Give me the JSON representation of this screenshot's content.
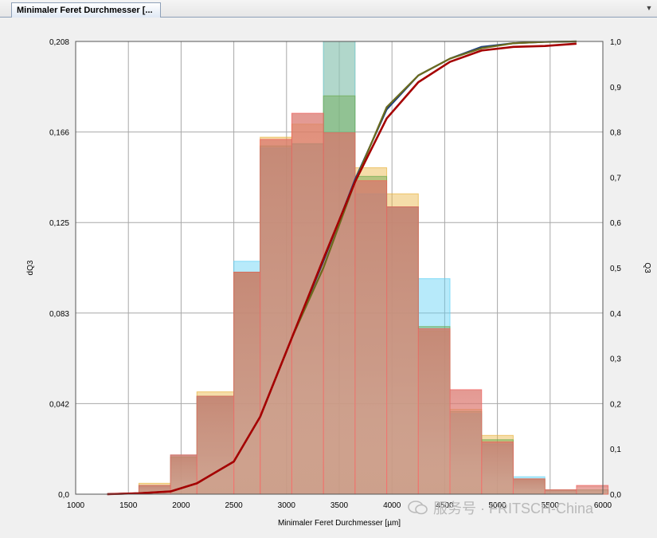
{
  "tab": {
    "title": "Minimaler Feret Durchmesser [..."
  },
  "watermark": {
    "text": "服务号 · FRITSCH-China"
  },
  "colors": {
    "blue": "#5fd0f5",
    "orange": "#e8b440",
    "green": "#6aa84f",
    "red": "#ff4a4a",
    "dark_red": "#a50000",
    "olive": "#6b6b1e",
    "navy": "#1f3f7a",
    "brown_fill": "#c98e80"
  },
  "chart_data": {
    "type": "bar",
    "xlabel": "Minimaler Feret Durchmesser [µm]",
    "ylabel": "dQ3",
    "y2label": "Q3",
    "xlim": [
      1000,
      6000
    ],
    "ylim": [
      0,
      0.208
    ],
    "y2lim": [
      0,
      1.0
    ],
    "x_ticks": [
      "1000",
      "1500",
      "2000",
      "2500",
      "3000",
      "3500",
      "4000",
      "4500",
      "5000",
      "5500",
      "6000"
    ],
    "y_ticks": [
      "0,0",
      "0,042",
      "0,083",
      "0,125",
      "0,166",
      "0,208"
    ],
    "y2_ticks": [
      "0,0",
      "0,1",
      "0,2",
      "0,3",
      "0,4",
      "0,5",
      "0,6",
      "0,7",
      "0,8",
      "0,9",
      "1,0"
    ],
    "bin_edges": [
      1300,
      1600,
      1900,
      2150,
      2500,
      2750,
      3050,
      3350,
      3650,
      3950,
      4250,
      4550,
      4850,
      5150,
      5450,
      5750
    ],
    "histogram_series": [
      {
        "color": "blue",
        "values": [
          0.0,
          0.004,
          0.018,
          0.045,
          0.107,
          0.159,
          0.161,
          0.208,
          0.138,
          0.132,
          0.099,
          0.037,
          0.023,
          0.008,
          0.002,
          0.002
        ]
      },
      {
        "color": "orange",
        "values": [
          0.0,
          0.005,
          0.018,
          0.047,
          0.102,
          0.164,
          0.17,
          0.208,
          0.15,
          0.138,
          0.075,
          0.039,
          0.027,
          0.007,
          0.002,
          0.002
        ]
      },
      {
        "color": "green",
        "values": [
          0.0,
          0.004,
          0.017,
          0.045,
          0.102,
          0.16,
          0.161,
          0.183,
          0.146,
          0.132,
          0.077,
          0.038,
          0.025,
          0.007,
          0.002,
          0.002
        ]
      },
      {
        "color": "red",
        "values": [
          0.0,
          0.004,
          0.018,
          0.045,
          0.102,
          0.163,
          0.175,
          0.166,
          0.144,
          0.132,
          0.076,
          0.048,
          0.024,
          0.007,
          0.002,
          0.004
        ]
      }
    ],
    "cumulative_series": [
      {
        "color": "navy",
        "x": [
          1300,
          1600,
          1900,
          2150,
          2500,
          2750,
          3050,
          3350,
          3650,
          3950,
          4250,
          4550,
          4850,
          5150,
          5450,
          5750
        ],
        "y": [
          0.0,
          0.002,
          0.006,
          0.024,
          0.072,
          0.171,
          0.345,
          0.515,
          0.695,
          0.85,
          0.925,
          0.962,
          0.988,
          0.996,
          0.999,
          1.0
        ]
      },
      {
        "color": "olive",
        "x": [
          1300,
          1600,
          1900,
          2150,
          2500,
          2750,
          3050,
          3350,
          3650,
          3950,
          4250,
          4550,
          4850,
          5150,
          5450,
          5750
        ],
        "y": [
          0.0,
          0.002,
          0.006,
          0.024,
          0.072,
          0.171,
          0.345,
          0.5,
          0.69,
          0.855,
          0.925,
          0.962,
          0.985,
          0.996,
          0.999,
          1.0
        ]
      },
      {
        "color": "dark_red",
        "x": [
          1300,
          1600,
          1900,
          2150,
          2500,
          2750,
          3050,
          3350,
          3650,
          3950,
          4250,
          4550,
          4850,
          5150,
          5450,
          5750
        ],
        "y": [
          0.0,
          0.002,
          0.006,
          0.024,
          0.072,
          0.171,
          0.345,
          0.52,
          0.69,
          0.83,
          0.91,
          0.955,
          0.98,
          0.988,
          0.99,
          0.995
        ]
      }
    ],
    "grid": true
  }
}
